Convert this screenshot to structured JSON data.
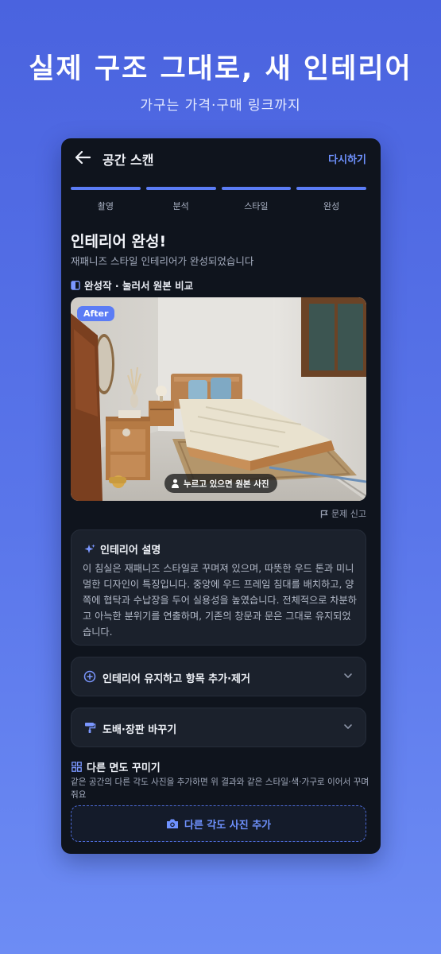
{
  "promo": {
    "headline": "실제 구조 그대로, 새 인테리어",
    "subline": "가구는 가격·구매 링크까지"
  },
  "topbar": {
    "title": "공간 스캔",
    "retry_label": "다시하기",
    "back_icon": "arrow-left-icon"
  },
  "steps": [
    {
      "label": "촬영"
    },
    {
      "label": "분석"
    },
    {
      "label": "스타일"
    },
    {
      "label": "완성"
    }
  ],
  "result": {
    "title": "인테리어 완성!",
    "subtitle": "재패니즈 스타일 인테리어가 완성되었습니다",
    "compare_label": "완성작 · 눌러서 원본 비교",
    "after_badge": "After",
    "hold_hint": "누르고 있으면 원본 사진",
    "report_label": "문제 신고"
  },
  "description": {
    "title": "인테리어 설명",
    "text": "이 침실은 재패니즈 스타일로 꾸며져 있으며, 따뜻한 우드 톤과 미니멀한 디자인이 특징입니다. 중앙에 우드 프레임 침대를 배치하고, 양쪽에 협탁과 수납장을 두어 실용성을 높였습니다. 전체적으로 차분하고 아늑한 분위기를 연출하며, 기존의 창문과 문은 그대로 유지되었습니다."
  },
  "accordions": [
    {
      "label": "인테리어 유지하고 항목 추가·제거",
      "icon": "plus-circle-icon"
    },
    {
      "label": "도배·장판 바꾸기",
      "icon": "paint-roller-icon"
    }
  ],
  "other_angle": {
    "title": "다른 면도 꾸미기",
    "subtitle": "같은 공간의 다른 각도 사진을 추가하면 위 결과와 같은 스타일·색·가구로 이어서 꾸며줘요",
    "button_label": "다른 각도 사진 추가"
  },
  "colors": {
    "accent": "#5b7cf5",
    "background_top": "#4a63df",
    "background_bottom": "#6d8cf4",
    "panel": "#0f141d"
  }
}
